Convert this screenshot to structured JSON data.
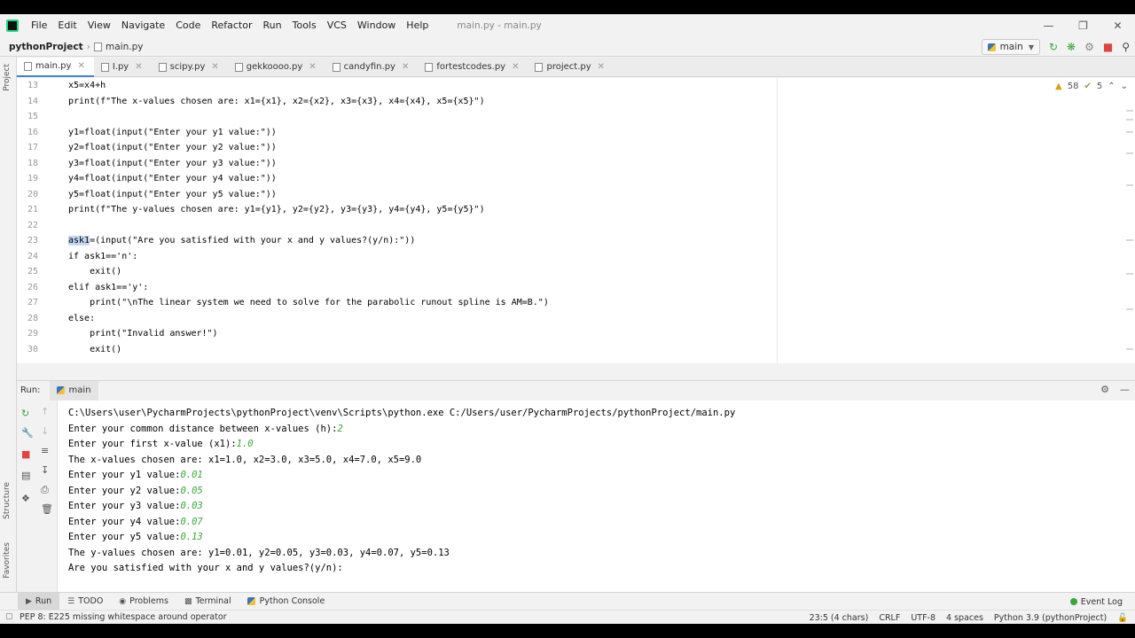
{
  "menu": {
    "items": [
      "File",
      "Edit",
      "View",
      "Navigate",
      "Code",
      "Refactor",
      "Run",
      "Tools",
      "VCS",
      "Window",
      "Help"
    ],
    "window_title": "main.py - main.py"
  },
  "nav": {
    "project": "pythonProject",
    "file": "main.py",
    "run_config": "main"
  },
  "left_strip": {
    "project": "Project",
    "structure": "Structure",
    "favorites": "Favorites"
  },
  "tabs": [
    "main.py",
    "I.py",
    "scipy.py",
    "gekkoooo.py",
    "candyfin.py",
    "fortestcodes.py",
    "project.py"
  ],
  "editor": {
    "inspections": {
      "warnings": "58",
      "weak": "5"
    },
    "lines": [
      {
        "num": "13",
        "text": "x5=x4+h"
      },
      {
        "num": "14",
        "text": "print(f\"The x-values chosen are: x1={x1}, x2={x2}, x3={x3}, x4={x4}, x5={x5}\")"
      },
      {
        "num": "15",
        "text": ""
      },
      {
        "num": "16",
        "text": "y1=float(input(\"Enter your y1 value:\"))"
      },
      {
        "num": "17",
        "text": "y2=float(input(\"Enter your y2 value:\"))"
      },
      {
        "num": "18",
        "text": "y3=float(input(\"Enter your y3 value:\"))"
      },
      {
        "num": "19",
        "text": "y4=float(input(\"Enter your y4 value:\"))"
      },
      {
        "num": "20",
        "text": "y5=float(input(\"Enter your y5 value:\"))"
      },
      {
        "num": "21",
        "text": "print(f\"The y-values chosen are: y1={y1}, y2={y2}, y3={y3}, y4={y4}, y5={y5}\")"
      },
      {
        "num": "22",
        "text": ""
      },
      {
        "num": "23",
        "sel": "ask1",
        "text": "=(input(\"Are you satisfied with your x and y values?(y/n):\"))"
      },
      {
        "num": "24",
        "text": "if ask1=='n':"
      },
      {
        "num": "25",
        "text": "    exit()"
      },
      {
        "num": "26",
        "text": "elif ask1=='y':"
      },
      {
        "num": "27",
        "text": "    print(\"\\nThe linear system we need to solve for the parabolic runout spline is AM=B.\")"
      },
      {
        "num": "28",
        "text": "else:"
      },
      {
        "num": "29",
        "text": "    print(\"Invalid answer!\")"
      },
      {
        "num": "30",
        "text": "    exit()"
      }
    ]
  },
  "run": {
    "label": "Run:",
    "tab": "main",
    "console": [
      {
        "out": "C:\\Users\\user\\PycharmProjects\\pythonProject\\venv\\Scripts\\python.exe C:/Users/user/PycharmProjects/pythonProject/main.py",
        "in": ""
      },
      {
        "out": "Enter your common distance between x-values (h):",
        "in": "2"
      },
      {
        "out": "Enter your first x-value (x1):",
        "in": "1.0"
      },
      {
        "out": "The x-values chosen are: x1=1.0, x2=3.0, x3=5.0, x4=7.0, x5=9.0",
        "in": ""
      },
      {
        "out": "Enter your y1 value:",
        "in": "0.01"
      },
      {
        "out": "Enter your y2 value:",
        "in": "0.05"
      },
      {
        "out": "Enter your y3 value:",
        "in": "0.03"
      },
      {
        "out": "Enter your y4 value:",
        "in": "0.07"
      },
      {
        "out": "Enter your y5 value:",
        "in": "0.13"
      },
      {
        "out": "The y-values chosen are: y1=0.01, y2=0.05, y3=0.03, y4=0.07, y5=0.13",
        "in": ""
      },
      {
        "out": "Are you satisfied with your x and y values?(y/n):",
        "in": ""
      }
    ]
  },
  "tool_tabs": [
    "Run",
    "TODO",
    "Problems",
    "Terminal",
    "Python Console"
  ],
  "event_log": "Event Log",
  "status": {
    "message": "PEP 8: E225 missing whitespace around operator",
    "position": "23:5 (4 chars)",
    "line_sep": "CRLF",
    "encoding": "UTF-8",
    "indent": "4 spaces",
    "interpreter": "Python 3.9 (pythonProject)"
  },
  "colors": {
    "accent": "#4083c9",
    "selection": "#c4d8f3",
    "input_text": "#3ba53b",
    "run_green": "#3ba53b",
    "stop_red": "#e0433f"
  }
}
